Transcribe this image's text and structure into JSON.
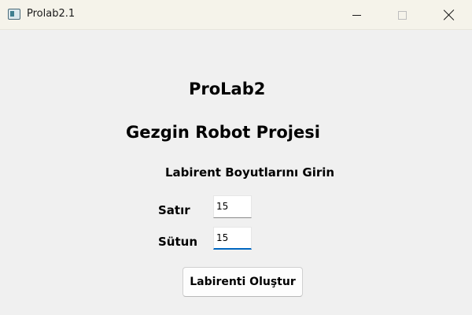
{
  "window": {
    "title": "Prolab2.1"
  },
  "main": {
    "title": "ProLab2",
    "project_name": "Gezgin Robot Projesi",
    "instruction": "Labirent Boyutlarını Girin",
    "rows_label": "Satır",
    "rows_value": "15",
    "cols_label": "Sütun",
    "cols_value": "15",
    "create_button_label": "Labirenti Oluştur"
  }
}
